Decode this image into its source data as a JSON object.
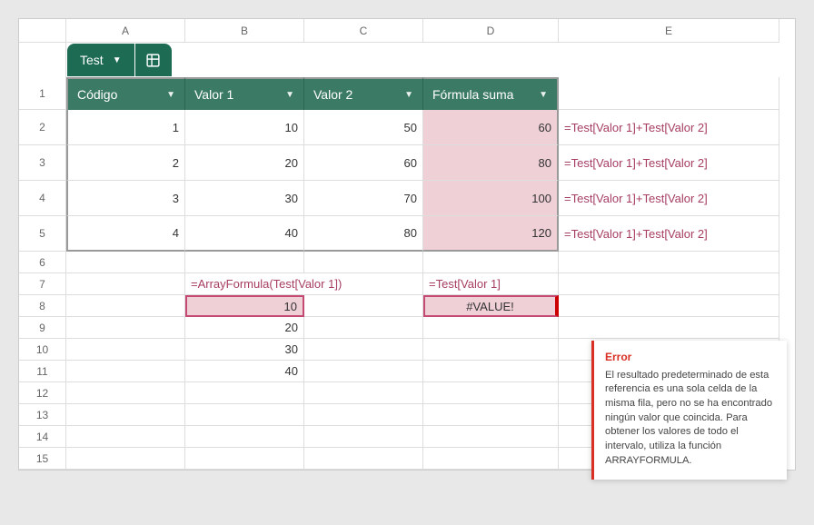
{
  "columns": [
    "A",
    "B",
    "C",
    "D",
    "E"
  ],
  "rows": [
    "1",
    "2",
    "3",
    "4",
    "5",
    "6",
    "7",
    "8",
    "9",
    "10",
    "11",
    "12",
    "13",
    "14",
    "15"
  ],
  "tab": {
    "name": "Test"
  },
  "headers": {
    "c0": "Código",
    "c1": "Valor 1",
    "c2": "Valor 2",
    "c3": "Fórmula suma"
  },
  "table": {
    "r2": {
      "a": "1",
      "b": "10",
      "c": "50",
      "d": "60",
      "e": "=Test[Valor 1]+Test[Valor 2]"
    },
    "r3": {
      "a": "2",
      "b": "20",
      "c": "60",
      "d": "80",
      "e": "=Test[Valor 1]+Test[Valor 2]"
    },
    "r4": {
      "a": "3",
      "b": "30",
      "c": "70",
      "d": "100",
      "e": "=Test[Valor 1]+Test[Valor 2]"
    },
    "r5": {
      "a": "4",
      "b": "40",
      "c": "80",
      "d": "120",
      "e": "=Test[Valor 1]+Test[Valor 2]"
    }
  },
  "lower": {
    "b7": "=ArrayFormula(Test[Valor 1])",
    "d7": "=Test[Valor 1]",
    "b8": "10",
    "d8": "#VALUE!",
    "b9": "20",
    "b10": "30",
    "b11": "40"
  },
  "tooltip": {
    "title": "Error",
    "body": "El resultado predeterminado de esta referencia es una sola celda de la misma fila, pero no se ha encontrado ningún valor que coincida. Para obtener los valores de todo el intervalo, utiliza la función ARRAYFORMULA."
  },
  "chart_data": {
    "type": "table",
    "title": "Test",
    "columns": [
      "Código",
      "Valor 1",
      "Valor 2",
      "Fórmula suma"
    ],
    "rows": [
      {
        "Código": 1,
        "Valor 1": 10,
        "Valor 2": 50,
        "Fórmula suma": 60
      },
      {
        "Código": 2,
        "Valor 1": 20,
        "Valor 2": 60,
        "Fórmula suma": 80
      },
      {
        "Código": 3,
        "Valor 1": 30,
        "Valor 2": 70,
        "Fórmula suma": 100
      },
      {
        "Código": 4,
        "Valor 1": 40,
        "Valor 2": 80,
        "Fórmula suma": 120
      }
    ]
  }
}
